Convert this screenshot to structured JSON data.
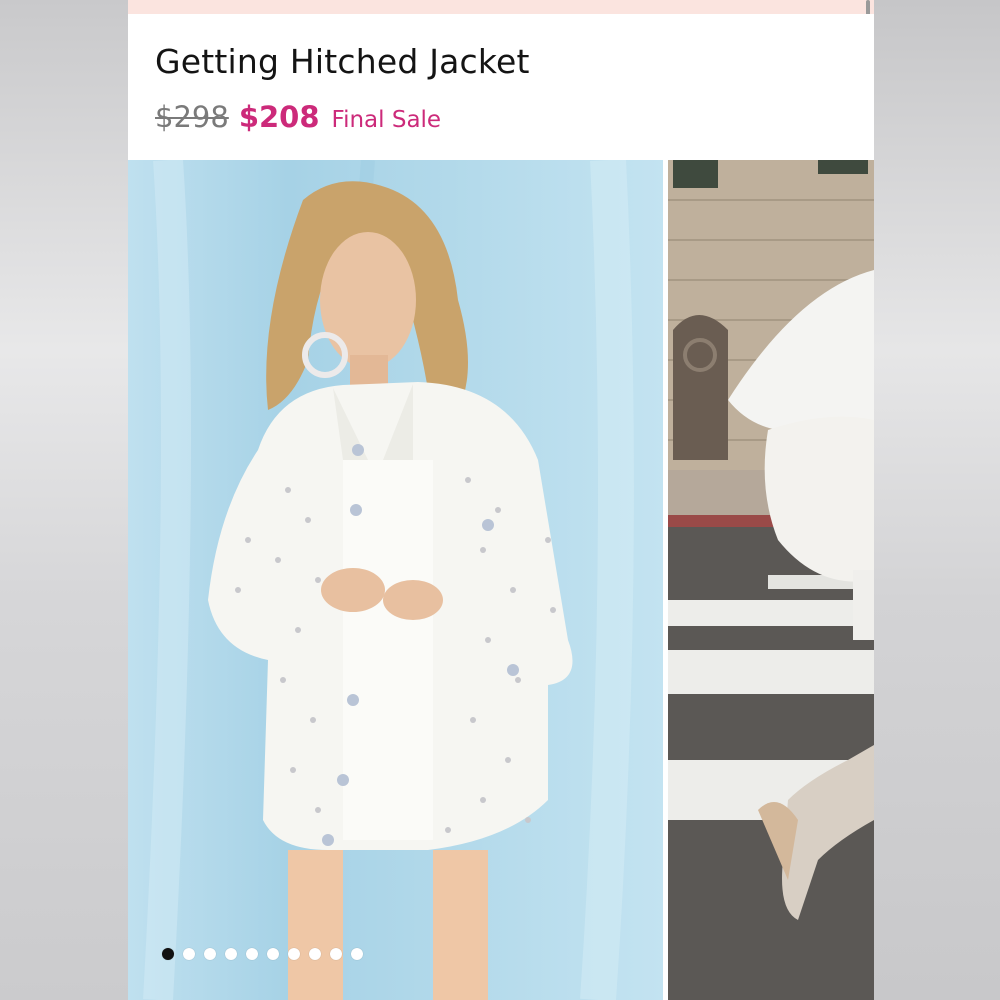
{
  "product": {
    "title": "Getting Hitched Jacket",
    "price_original": "$298",
    "price_sale": "$208",
    "sale_tag": "Final Sale"
  },
  "colors": {
    "sale_accent": "#cc2a7a",
    "strikethrough": "#7a7a7a",
    "promo_strip": "#fbe4df"
  },
  "gallery": {
    "image_count": 10,
    "active_index": 0,
    "images": [
      {
        "name": "model-front-photo"
      },
      {
        "name": "model-crosswalk-photo"
      }
    ]
  }
}
